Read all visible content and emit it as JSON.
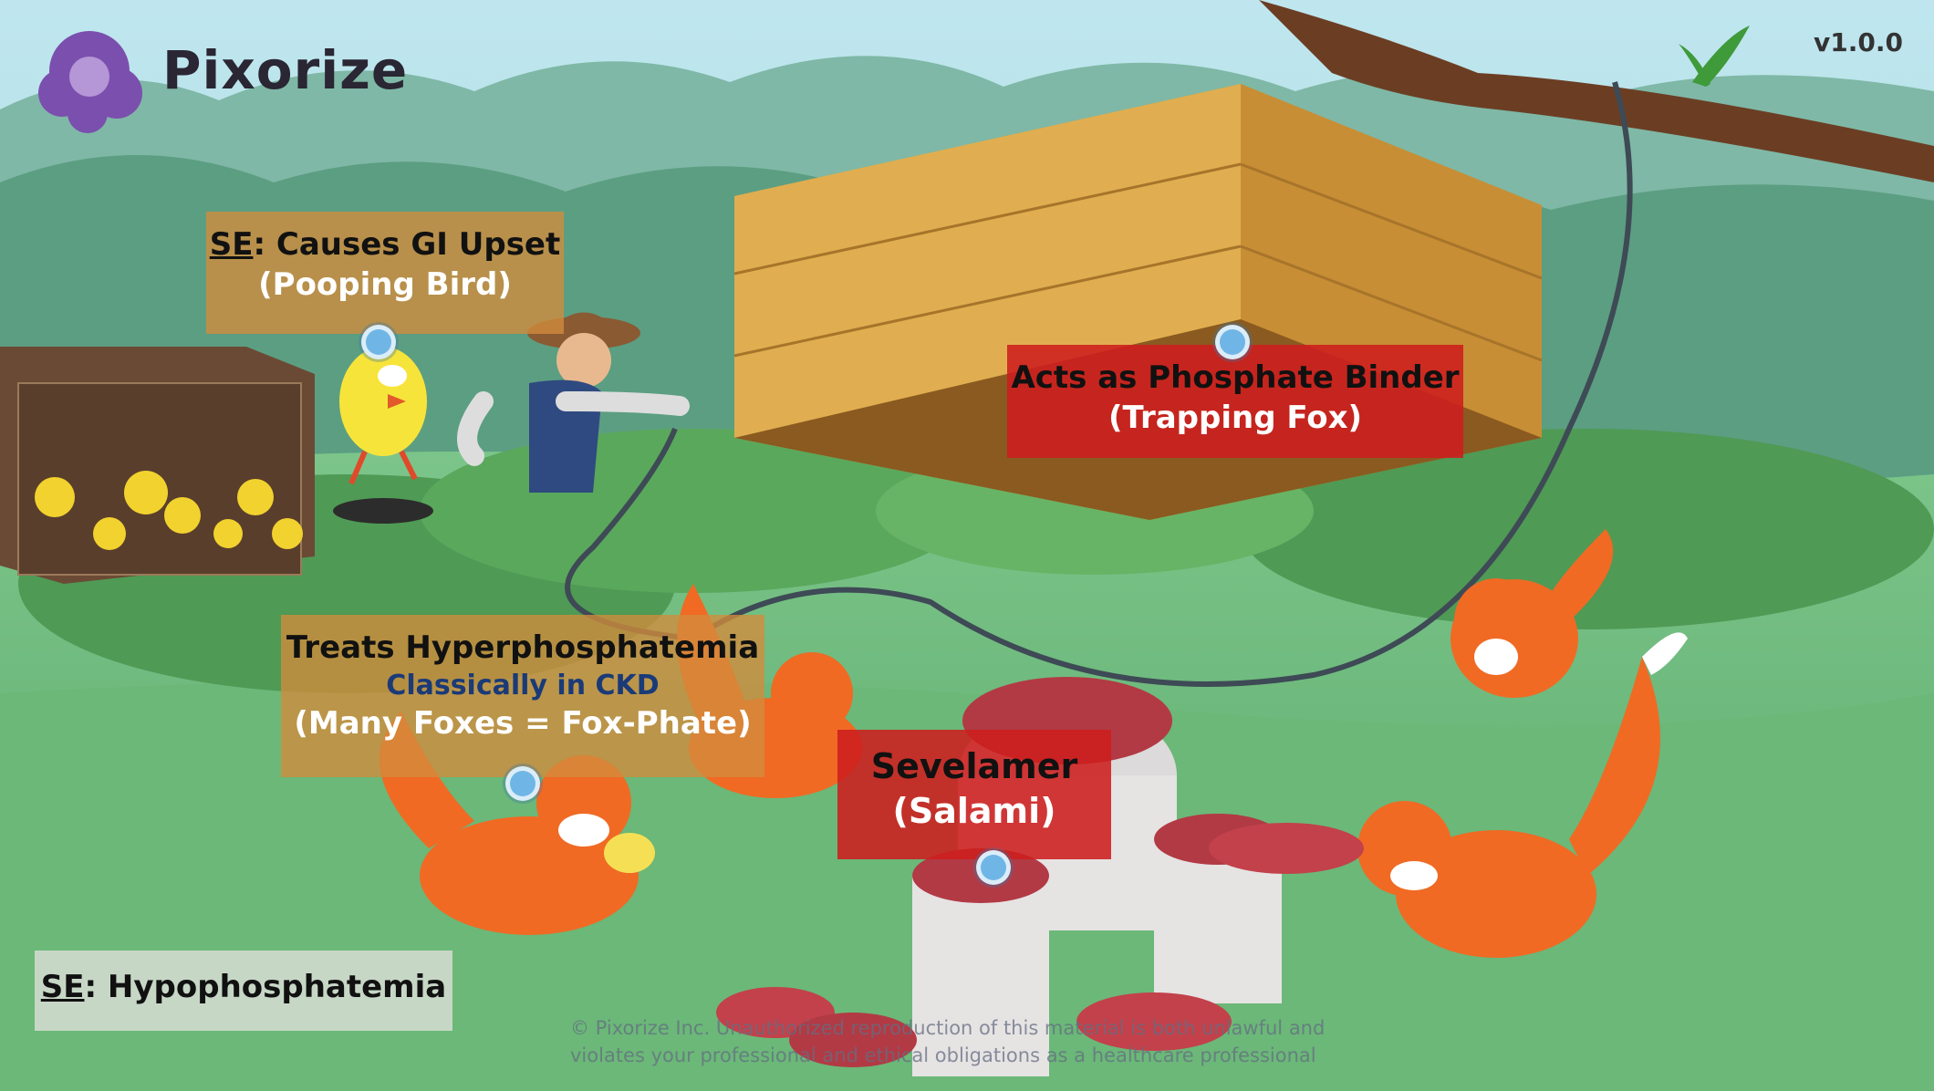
{
  "app": {
    "logo_text": "Pixorize",
    "version": "v1.0.0"
  },
  "labels": {
    "gi_upset": {
      "prefix": "SE",
      "line1": ": Causes GI Upset",
      "line2": "(Pooping Bird)"
    },
    "phosphate_binder": {
      "line1": "Acts as Phosphate Binder",
      "line2": "(Trapping Fox)"
    },
    "hyperphosphatemia": {
      "line1": "Treats Hyperphosphatemia",
      "line2": "Classically in CKD",
      "line3": "(Many Foxes = Fox-Phate)"
    },
    "sevelamer": {
      "line1": "Sevelamer",
      "line2": "(Salami)"
    },
    "hypophosphatemia": {
      "prefix": "SE",
      "line1": ": Hypophosphatemia"
    }
  },
  "watermark": {
    "line1": "© Pixorize Inc. Unauthorized reproduction of this material is both unlawful and",
    "line2": "violates your professional and ethical obligations as a healthcare professional"
  },
  "colors": {
    "orange_label": "#d28c3c",
    "red_label": "#cd1e1e",
    "hotspot": "#6fb6e6",
    "logo_purple": "#7b4fae"
  }
}
